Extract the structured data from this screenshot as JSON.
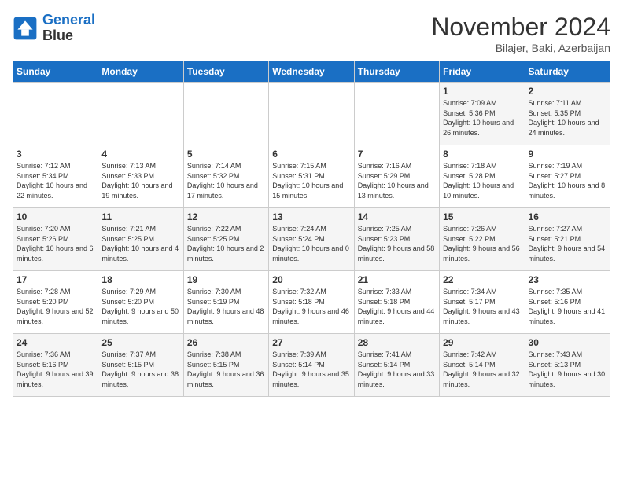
{
  "header": {
    "logo_line1": "General",
    "logo_line2": "Blue",
    "month": "November 2024",
    "location": "Bilajer, Baki, Azerbaijan"
  },
  "days_of_week": [
    "Sunday",
    "Monday",
    "Tuesday",
    "Wednesday",
    "Thursday",
    "Friday",
    "Saturday"
  ],
  "weeks": [
    [
      {
        "day": "",
        "sunrise": "",
        "sunset": "",
        "daylight": ""
      },
      {
        "day": "",
        "sunrise": "",
        "sunset": "",
        "daylight": ""
      },
      {
        "day": "",
        "sunrise": "",
        "sunset": "",
        "daylight": ""
      },
      {
        "day": "",
        "sunrise": "",
        "sunset": "",
        "daylight": ""
      },
      {
        "day": "",
        "sunrise": "",
        "sunset": "",
        "daylight": ""
      },
      {
        "day": "1",
        "sunrise": "Sunrise: 7:09 AM",
        "sunset": "Sunset: 5:36 PM",
        "daylight": "Daylight: 10 hours and 26 minutes."
      },
      {
        "day": "2",
        "sunrise": "Sunrise: 7:11 AM",
        "sunset": "Sunset: 5:35 PM",
        "daylight": "Daylight: 10 hours and 24 minutes."
      }
    ],
    [
      {
        "day": "3",
        "sunrise": "Sunrise: 7:12 AM",
        "sunset": "Sunset: 5:34 PM",
        "daylight": "Daylight: 10 hours and 22 minutes."
      },
      {
        "day": "4",
        "sunrise": "Sunrise: 7:13 AM",
        "sunset": "Sunset: 5:33 PM",
        "daylight": "Daylight: 10 hours and 19 minutes."
      },
      {
        "day": "5",
        "sunrise": "Sunrise: 7:14 AM",
        "sunset": "Sunset: 5:32 PM",
        "daylight": "Daylight: 10 hours and 17 minutes."
      },
      {
        "day": "6",
        "sunrise": "Sunrise: 7:15 AM",
        "sunset": "Sunset: 5:31 PM",
        "daylight": "Daylight: 10 hours and 15 minutes."
      },
      {
        "day": "7",
        "sunrise": "Sunrise: 7:16 AM",
        "sunset": "Sunset: 5:29 PM",
        "daylight": "Daylight: 10 hours and 13 minutes."
      },
      {
        "day": "8",
        "sunrise": "Sunrise: 7:18 AM",
        "sunset": "Sunset: 5:28 PM",
        "daylight": "Daylight: 10 hours and 10 minutes."
      },
      {
        "day": "9",
        "sunrise": "Sunrise: 7:19 AM",
        "sunset": "Sunset: 5:27 PM",
        "daylight": "Daylight: 10 hours and 8 minutes."
      }
    ],
    [
      {
        "day": "10",
        "sunrise": "Sunrise: 7:20 AM",
        "sunset": "Sunset: 5:26 PM",
        "daylight": "Daylight: 10 hours and 6 minutes."
      },
      {
        "day": "11",
        "sunrise": "Sunrise: 7:21 AM",
        "sunset": "Sunset: 5:25 PM",
        "daylight": "Daylight: 10 hours and 4 minutes."
      },
      {
        "day": "12",
        "sunrise": "Sunrise: 7:22 AM",
        "sunset": "Sunset: 5:25 PM",
        "daylight": "Daylight: 10 hours and 2 minutes."
      },
      {
        "day": "13",
        "sunrise": "Sunrise: 7:24 AM",
        "sunset": "Sunset: 5:24 PM",
        "daylight": "Daylight: 10 hours and 0 minutes."
      },
      {
        "day": "14",
        "sunrise": "Sunrise: 7:25 AM",
        "sunset": "Sunset: 5:23 PM",
        "daylight": "Daylight: 9 hours and 58 minutes."
      },
      {
        "day": "15",
        "sunrise": "Sunrise: 7:26 AM",
        "sunset": "Sunset: 5:22 PM",
        "daylight": "Daylight: 9 hours and 56 minutes."
      },
      {
        "day": "16",
        "sunrise": "Sunrise: 7:27 AM",
        "sunset": "Sunset: 5:21 PM",
        "daylight": "Daylight: 9 hours and 54 minutes."
      }
    ],
    [
      {
        "day": "17",
        "sunrise": "Sunrise: 7:28 AM",
        "sunset": "Sunset: 5:20 PM",
        "daylight": "Daylight: 9 hours and 52 minutes."
      },
      {
        "day": "18",
        "sunrise": "Sunrise: 7:29 AM",
        "sunset": "Sunset: 5:20 PM",
        "daylight": "Daylight: 9 hours and 50 minutes."
      },
      {
        "day": "19",
        "sunrise": "Sunrise: 7:30 AM",
        "sunset": "Sunset: 5:19 PM",
        "daylight": "Daylight: 9 hours and 48 minutes."
      },
      {
        "day": "20",
        "sunrise": "Sunrise: 7:32 AM",
        "sunset": "Sunset: 5:18 PM",
        "daylight": "Daylight: 9 hours and 46 minutes."
      },
      {
        "day": "21",
        "sunrise": "Sunrise: 7:33 AM",
        "sunset": "Sunset: 5:18 PM",
        "daylight": "Daylight: 9 hours and 44 minutes."
      },
      {
        "day": "22",
        "sunrise": "Sunrise: 7:34 AM",
        "sunset": "Sunset: 5:17 PM",
        "daylight": "Daylight: 9 hours and 43 minutes."
      },
      {
        "day": "23",
        "sunrise": "Sunrise: 7:35 AM",
        "sunset": "Sunset: 5:16 PM",
        "daylight": "Daylight: 9 hours and 41 minutes."
      }
    ],
    [
      {
        "day": "24",
        "sunrise": "Sunrise: 7:36 AM",
        "sunset": "Sunset: 5:16 PM",
        "daylight": "Daylight: 9 hours and 39 minutes."
      },
      {
        "day": "25",
        "sunrise": "Sunrise: 7:37 AM",
        "sunset": "Sunset: 5:15 PM",
        "daylight": "Daylight: 9 hours and 38 minutes."
      },
      {
        "day": "26",
        "sunrise": "Sunrise: 7:38 AM",
        "sunset": "Sunset: 5:15 PM",
        "daylight": "Daylight: 9 hours and 36 minutes."
      },
      {
        "day": "27",
        "sunrise": "Sunrise: 7:39 AM",
        "sunset": "Sunset: 5:14 PM",
        "daylight": "Daylight: 9 hours and 35 minutes."
      },
      {
        "day": "28",
        "sunrise": "Sunrise: 7:41 AM",
        "sunset": "Sunset: 5:14 PM",
        "daylight": "Daylight: 9 hours and 33 minutes."
      },
      {
        "day": "29",
        "sunrise": "Sunrise: 7:42 AM",
        "sunset": "Sunset: 5:14 PM",
        "daylight": "Daylight: 9 hours and 32 minutes."
      },
      {
        "day": "30",
        "sunrise": "Sunrise: 7:43 AM",
        "sunset": "Sunset: 5:13 PM",
        "daylight": "Daylight: 9 hours and 30 minutes."
      }
    ]
  ]
}
